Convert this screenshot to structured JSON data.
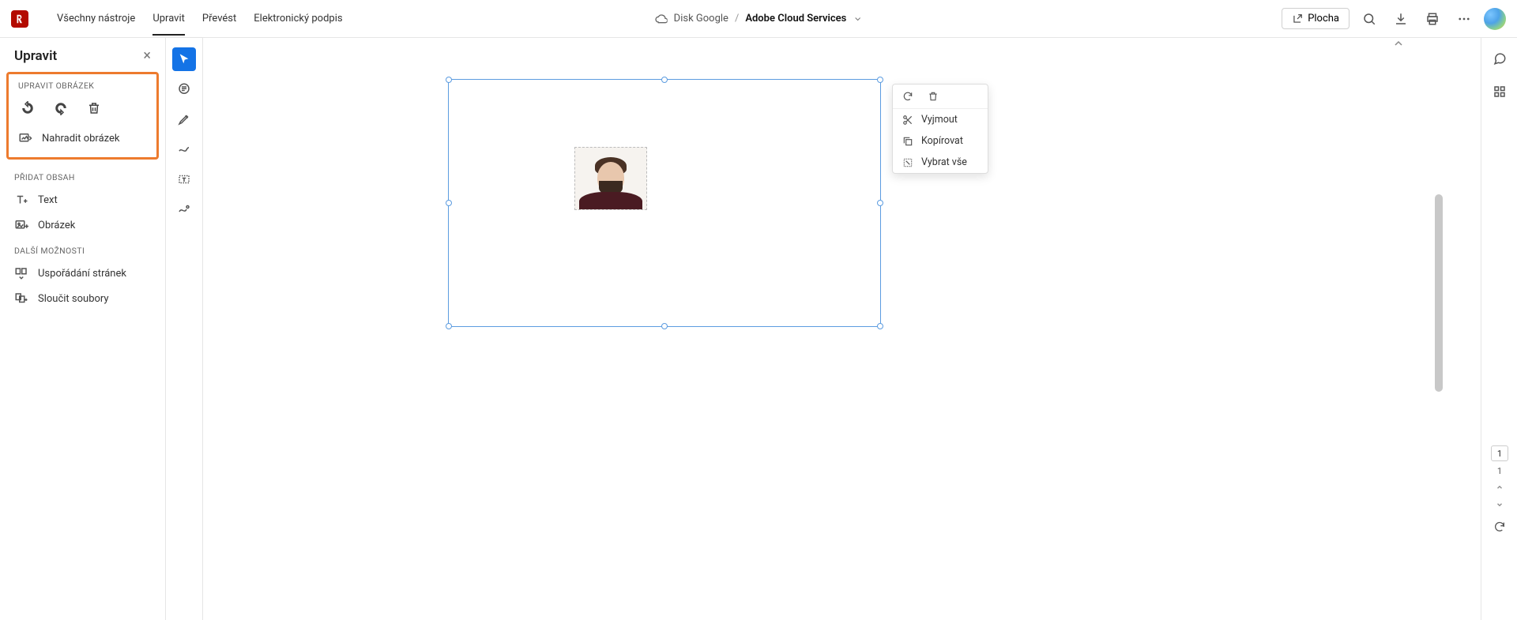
{
  "topnav": {
    "items": [
      "Všechny nástroje",
      "Upravit",
      "Převést",
      "Elektronický podpis"
    ],
    "active_index": 1
  },
  "breadcrumb": {
    "cloud_icon": "cloud-icon",
    "drive": "Disk Google",
    "separator": "/",
    "file": "Adobe Cloud Services"
  },
  "top_actions": {
    "share_label": "Plocha"
  },
  "sidepanel": {
    "title": "Upravit",
    "sections": {
      "edit_image": {
        "label": "UPRAVIT OBRÁZEK",
        "replace_label": "Nahradit obrázek"
      },
      "add_content": {
        "label": "PŘIDAT OBSAH",
        "text_label": "Text",
        "image_label": "Obrázek"
      },
      "more": {
        "label": "DALŠÍ MOŽNOSTI",
        "organize_label": "Uspořádání stránek",
        "merge_label": "Sloučit soubory"
      }
    }
  },
  "context_menu": {
    "cut": "Vyjmout",
    "copy": "Kopírovat",
    "select_all": "Vybrat vše"
  },
  "page_nav": {
    "current": "1",
    "total": "1"
  }
}
